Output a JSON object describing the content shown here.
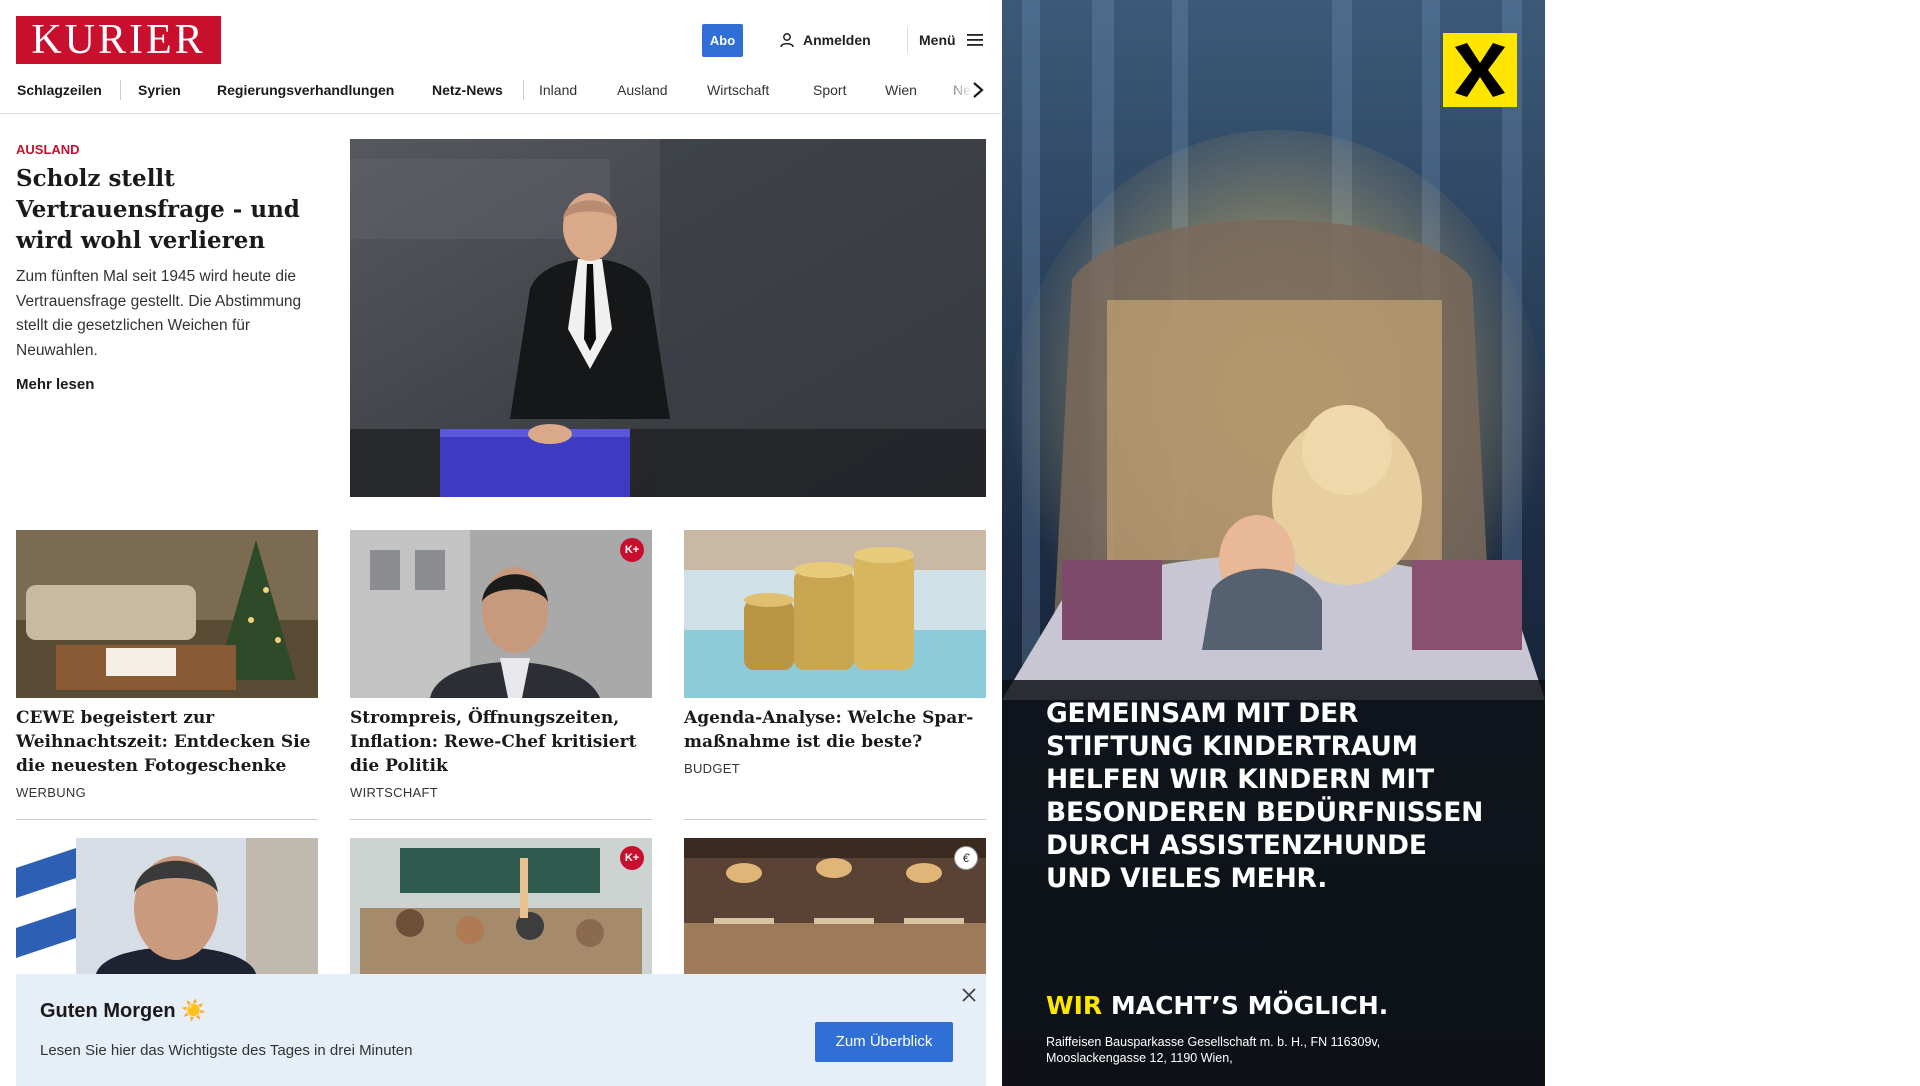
{
  "header": {
    "logo_text": "KURIER",
    "abo_label": "Abo",
    "login_label": "Anmelden",
    "menu_label": "Menü"
  },
  "nav": {
    "items": [
      "Schlagzeilen",
      "Syrien",
      "Regierungsverhandlungen",
      "Netz-News",
      "Inland",
      "Ausland",
      "Wirtschaft",
      "Sport",
      "Wien",
      "Ne"
    ]
  },
  "lead": {
    "category": "AUSLAND",
    "title": "Scholz stellt Vertrauens­frage - und wird wohl verlieren",
    "teaser": "Zum fünften Mal seit 1945 wird heute die Vertrauensfrage gestellt. Die Abstimmung stellt die gesetzlichen Weichen für Neuwahlen.",
    "more_label": "Mehr lesen"
  },
  "cards": [
    {
      "title": "CEWE begeistert zur Weihnachts­zeit: Entdecken Sie die neuesten Fotogeschenke",
      "category": "WERBUNG",
      "badge": ""
    },
    {
      "title": "Strompreis, Öffnungszeiten, Infla­tion: Rewe-Chef kritisiert die Politik",
      "category": "WIRTSCHAFT",
      "badge": "K+"
    },
    {
      "title": "Agenda-Analyse: Welche Spar­maßnahme ist die beste?",
      "category": "BUDGET",
      "badge": ""
    }
  ],
  "row2_badges": [
    "",
    "K+",
    "€"
  ],
  "popup": {
    "title": "Guten Morgen ☀️",
    "text": "Lesen Sie hier das Wichtigste des Tages in drei Minuten",
    "button_label": "Zum Überblick"
  },
  "ad": {
    "headline_lines": [
      "GEMEINSAM MIT DER",
      "STIFTUNG KINDERTRAUM",
      "HELFEN WIR KINDERN MIT",
      "BESONDEREN BEDÜRFNISSEN",
      "DURCH ASSISTENZHUNDE",
      "UND VIELES MEHR."
    ],
    "slogan_highlight": "WIR",
    "slogan_rest": " MACHT’S MÖGLICH.",
    "legal_line1": "Raiffeisen Bausparkasse Gesellschaft m. b. H., FN 116309v,",
    "legal_line2": "Mooslackengasse 12, 1190 Wien,"
  },
  "colors": {
    "brand_red": "#c8102e",
    "accent_blue": "#2f6fd6",
    "popup_bg": "#e6eef7",
    "raiffeisen_yellow": "#ffe600"
  }
}
